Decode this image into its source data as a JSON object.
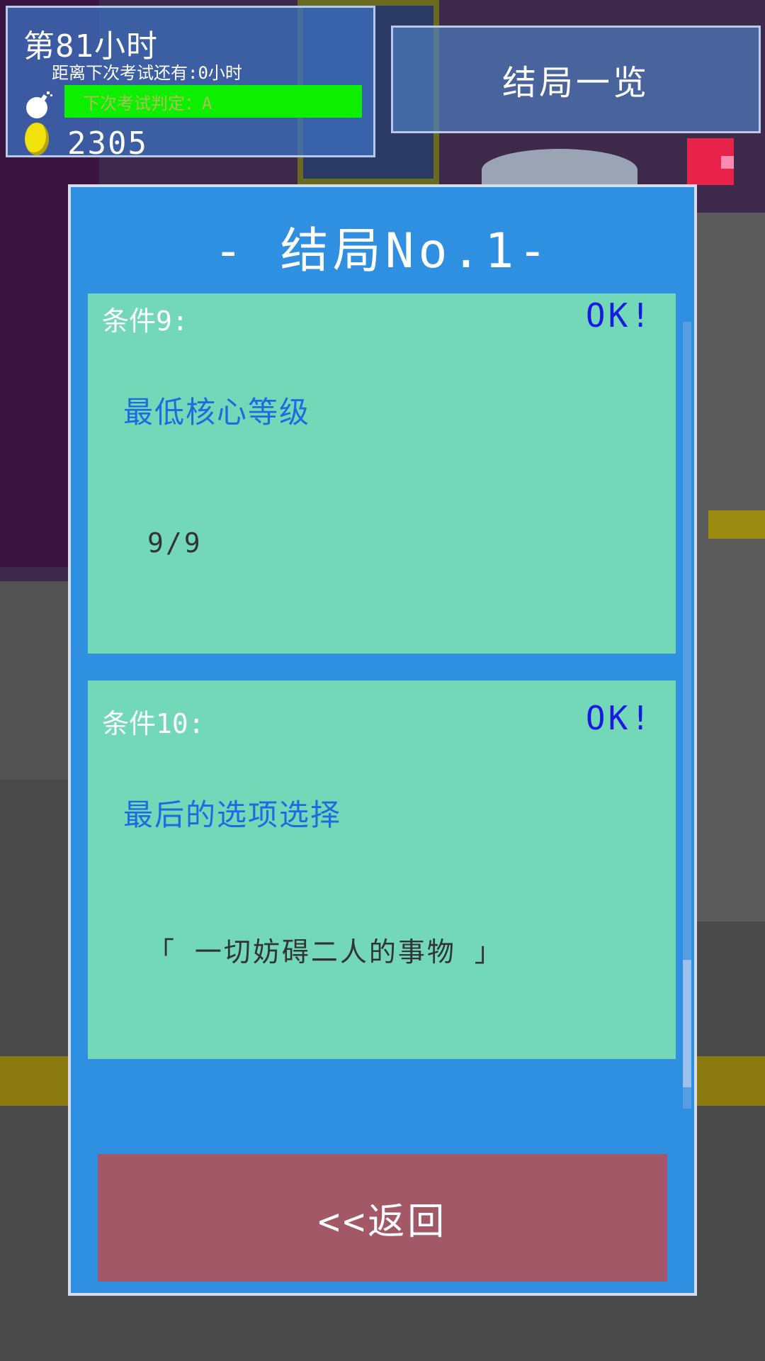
{
  "hud": {
    "hour": "第81小时",
    "exam_countdown": "距离下次考试还有:0小时",
    "exam_grade": "下次考试判定：A",
    "gold": "2305"
  },
  "top_button": {
    "label": "结局一览"
  },
  "panel": {
    "title": "- 结局No.1-",
    "conditions": [
      {
        "label": "条件9:",
        "status": "OK!",
        "name": "最低核心等级",
        "value": "9/9"
      },
      {
        "label": "条件10:",
        "status": "OK!",
        "name": "最后的选项选择",
        "value": "「 一切妨碍二人的事物 」"
      }
    ],
    "back_label": "<<返回"
  },
  "colors": {
    "panel_bg": "#2f8fe0",
    "card_bg": "#72d8b8",
    "ok_text": "#1a1ae0",
    "condition_name": "#1e6ae0",
    "back_button": "#a35868",
    "grade_bar": "#0cf000"
  },
  "icons": [
    "bomb-icon",
    "coin-icon"
  ]
}
